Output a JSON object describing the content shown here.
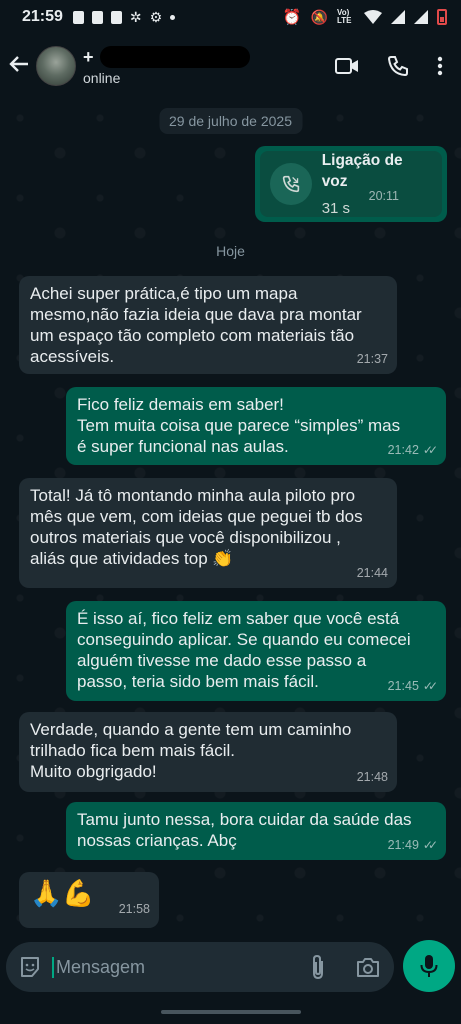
{
  "status_bar": {
    "time": "21:59",
    "network_label": "Vo) LTE",
    "battery_color": "#e24a4a"
  },
  "header": {
    "contact_name_prefix": "+",
    "status": "online",
    "icons": [
      "back-arrow-icon",
      "video-call-icon",
      "phone-icon",
      "more-vert-icon"
    ]
  },
  "chat": {
    "date_old": "29 de julho de 2025",
    "call": {
      "title": "Ligação de voz",
      "duration": "31 s",
      "time": "20:11"
    },
    "date_today": "Hoje",
    "messages": [
      {
        "dir": "in",
        "lines": [
          "Achei super prática,é tipo um mapa",
          "mesmo,não fazia ideia que dava pra montar",
          "um espaço tão completo com materiais tão",
          "acessíveis."
        ],
        "time": "21:37"
      },
      {
        "dir": "out",
        "lines": [
          "Fico feliz demais em saber!",
          "Tem muita coisa que parece “simples” mas",
          "é super funcional nas aulas."
        ],
        "time": "21:42"
      },
      {
        "dir": "in",
        "lines": [
          "Total! Já tô montando minha aula piloto pro",
          "mês que vem, com ideias que peguei tb dos",
          "outros materiais que você disponibilizou ,",
          "aliás que atividades top 👏"
        ],
        "time": "21:44"
      },
      {
        "dir": "out",
        "lines": [
          "É isso aí, fico feliz em saber que você está",
          "conseguindo aplicar. Se quando eu comecei",
          "alguém tivesse me dado esse passo a",
          "passo, teria sido bem mais fácil."
        ],
        "time": "21:45"
      },
      {
        "dir": "in",
        "lines": [
          "Verdade, quando a gente tem um caminho",
          "trilhado fica bem mais fácil.",
          "Muito obgrigado!"
        ],
        "time": "21:48"
      },
      {
        "dir": "out",
        "lines": [
          "Tamu junto nessa, bora cuidar da saúde das",
          "nossas crianças. Abç"
        ],
        "time": "21:49"
      },
      {
        "dir": "in",
        "lines": [
          "🙏💪"
        ],
        "time": "21:58"
      }
    ]
  },
  "input": {
    "placeholder": "Mensagem",
    "icons": [
      "sticker-icon",
      "attach-icon",
      "camera-icon",
      "mic-icon"
    ],
    "mic_color": "#00a884"
  },
  "colors": {
    "background": "#0b141a",
    "incoming_bubble": "#202c33",
    "outgoing_bubble": "#005c4b"
  }
}
